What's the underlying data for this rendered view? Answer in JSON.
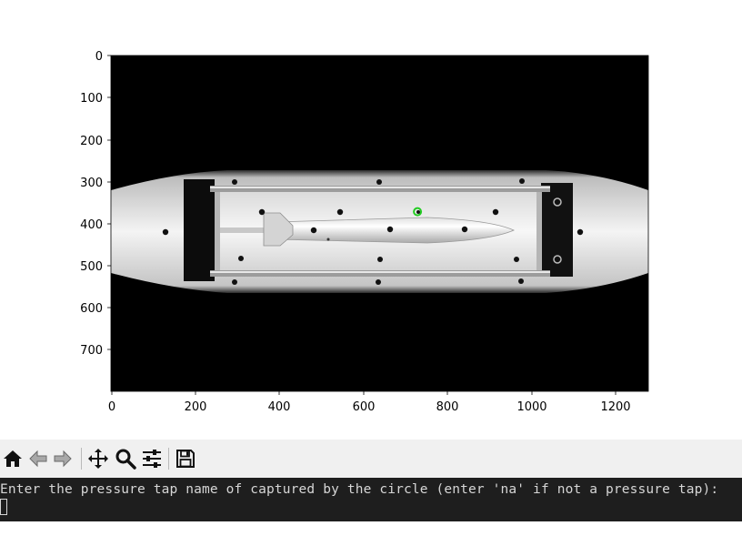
{
  "figure": {
    "x_ticks": [
      "0",
      "200",
      "400",
      "600",
      "800",
      "1000",
      "1200"
    ],
    "y_ticks": [
      "0",
      "100",
      "200",
      "300",
      "400",
      "500",
      "600",
      "700"
    ],
    "image_extent": {
      "x": [
        0,
        1280
      ],
      "y": [
        800,
        0
      ]
    },
    "highlight_circle": {
      "x": 730,
      "y": 372,
      "color": "#22cc22"
    }
  },
  "toolbar": {
    "buttons": [
      "home-icon",
      "back-arrow-icon",
      "forward-arrow-icon",
      "pan-icon",
      "zoom-icon",
      "configure-subplots-icon",
      "save-icon"
    ]
  },
  "terminal": {
    "prompt": "Enter the pressure tap name of captured by the circle (enter 'na' if not a pressure tap):",
    "input_value": ""
  }
}
